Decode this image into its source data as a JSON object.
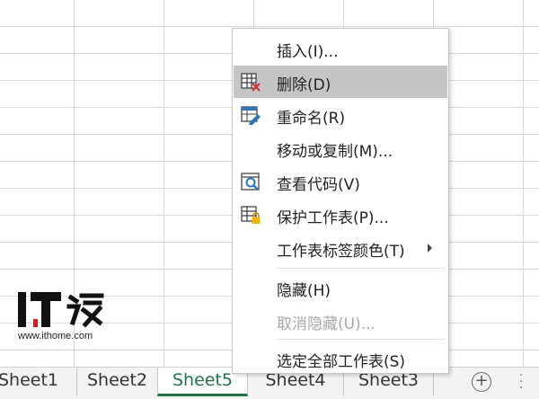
{
  "menu": {
    "items": [
      {
        "label": "插入(I)...",
        "icon": "",
        "disabled": false,
        "hover": false
      },
      {
        "label": "删除(D)",
        "icon": "delete-sheet-icon",
        "disabled": false,
        "hover": true
      },
      {
        "label": "重命名(R)",
        "icon": "rename-sheet-icon",
        "disabled": false,
        "hover": false
      },
      {
        "label": "移动或复制(M)...",
        "icon": "",
        "disabled": false,
        "hover": false
      },
      {
        "label": "查看代码(V)",
        "icon": "view-code-icon",
        "disabled": false,
        "hover": false
      },
      {
        "label": "保护工作表(P)...",
        "icon": "protect-sheet-icon",
        "disabled": false,
        "hover": false
      },
      {
        "label": "工作表标签颜色(T)",
        "icon": "",
        "disabled": false,
        "hover": false,
        "submenu": true
      },
      {
        "label": "隐藏(H)",
        "icon": "",
        "disabled": false,
        "hover": false
      },
      {
        "label": "取消隐藏(U)...",
        "icon": "",
        "disabled": true,
        "hover": false
      },
      {
        "label": "选定全部工作表(S)",
        "icon": "",
        "disabled": false,
        "hover": false
      }
    ]
  },
  "tabs": [
    {
      "label": "Sheet1",
      "active": false
    },
    {
      "label": "Sheet2",
      "active": false
    },
    {
      "label": "Sheet5",
      "active": true
    },
    {
      "label": "Sheet4",
      "active": false
    },
    {
      "label": "Sheet3",
      "active": false
    }
  ],
  "watermark": {
    "logo_text": "IT之家",
    "url": "www.ithome.com"
  },
  "colors": {
    "active_tab": "#217346",
    "hover_bg": "#c5c5c5",
    "disabled_text": "#a8a8a8"
  }
}
